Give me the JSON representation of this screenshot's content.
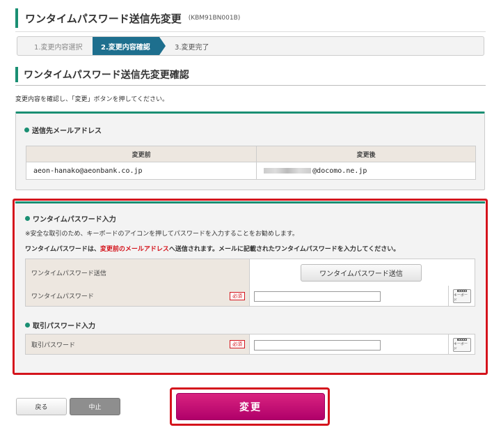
{
  "header": {
    "title": "ワンタイムパスワード送信先変更",
    "code": "(KBM91BN001B)"
  },
  "steps": [
    {
      "label": "1.変更内容選択"
    },
    {
      "label": "2.変更内容確認"
    },
    {
      "label": "3.変更完了"
    }
  ],
  "section": {
    "title": "ワンタイムパスワード送信先変更確認",
    "intro": "変更内容を確認し、「変更」ボタンを押してください。"
  },
  "email": {
    "heading": "送信先メールアドレス",
    "before_header": "変更前",
    "after_header": "変更後",
    "before_value": "aeon-hanako@aeonbank.co.jp",
    "after_value": "@docomo.ne.jp"
  },
  "otp": {
    "heading": "ワンタイムパスワード入力",
    "note": "※安全な取引のため、キーボードのアイコンを押してパスワードを入力することをお勧めします。",
    "info_prefix": "ワンタイムパスワードは、",
    "info_highlight": "変更前のメールアドレス",
    "info_suffix": "へ送信されます。メールに記載されたワンタイムパスワードを入力してください。",
    "send_label": "ワンタイムパスワード送信",
    "send_button": "ワンタイムパスワード送信",
    "input_label": "ワンタイムパスワード",
    "required": "必須",
    "keyboard_label": "キーボード"
  },
  "txn": {
    "heading": "取引パスワード入力",
    "input_label": "取引パスワード",
    "required": "必須",
    "keyboard_label": "キーボード"
  },
  "buttons": {
    "back": "戻る",
    "cancel": "中止",
    "submit": "変更"
  },
  "colors": {
    "accent": "#1a8f73",
    "step_active": "#1e6f8e",
    "highlight_red": "#d4141c",
    "submit": "#c0157a"
  }
}
